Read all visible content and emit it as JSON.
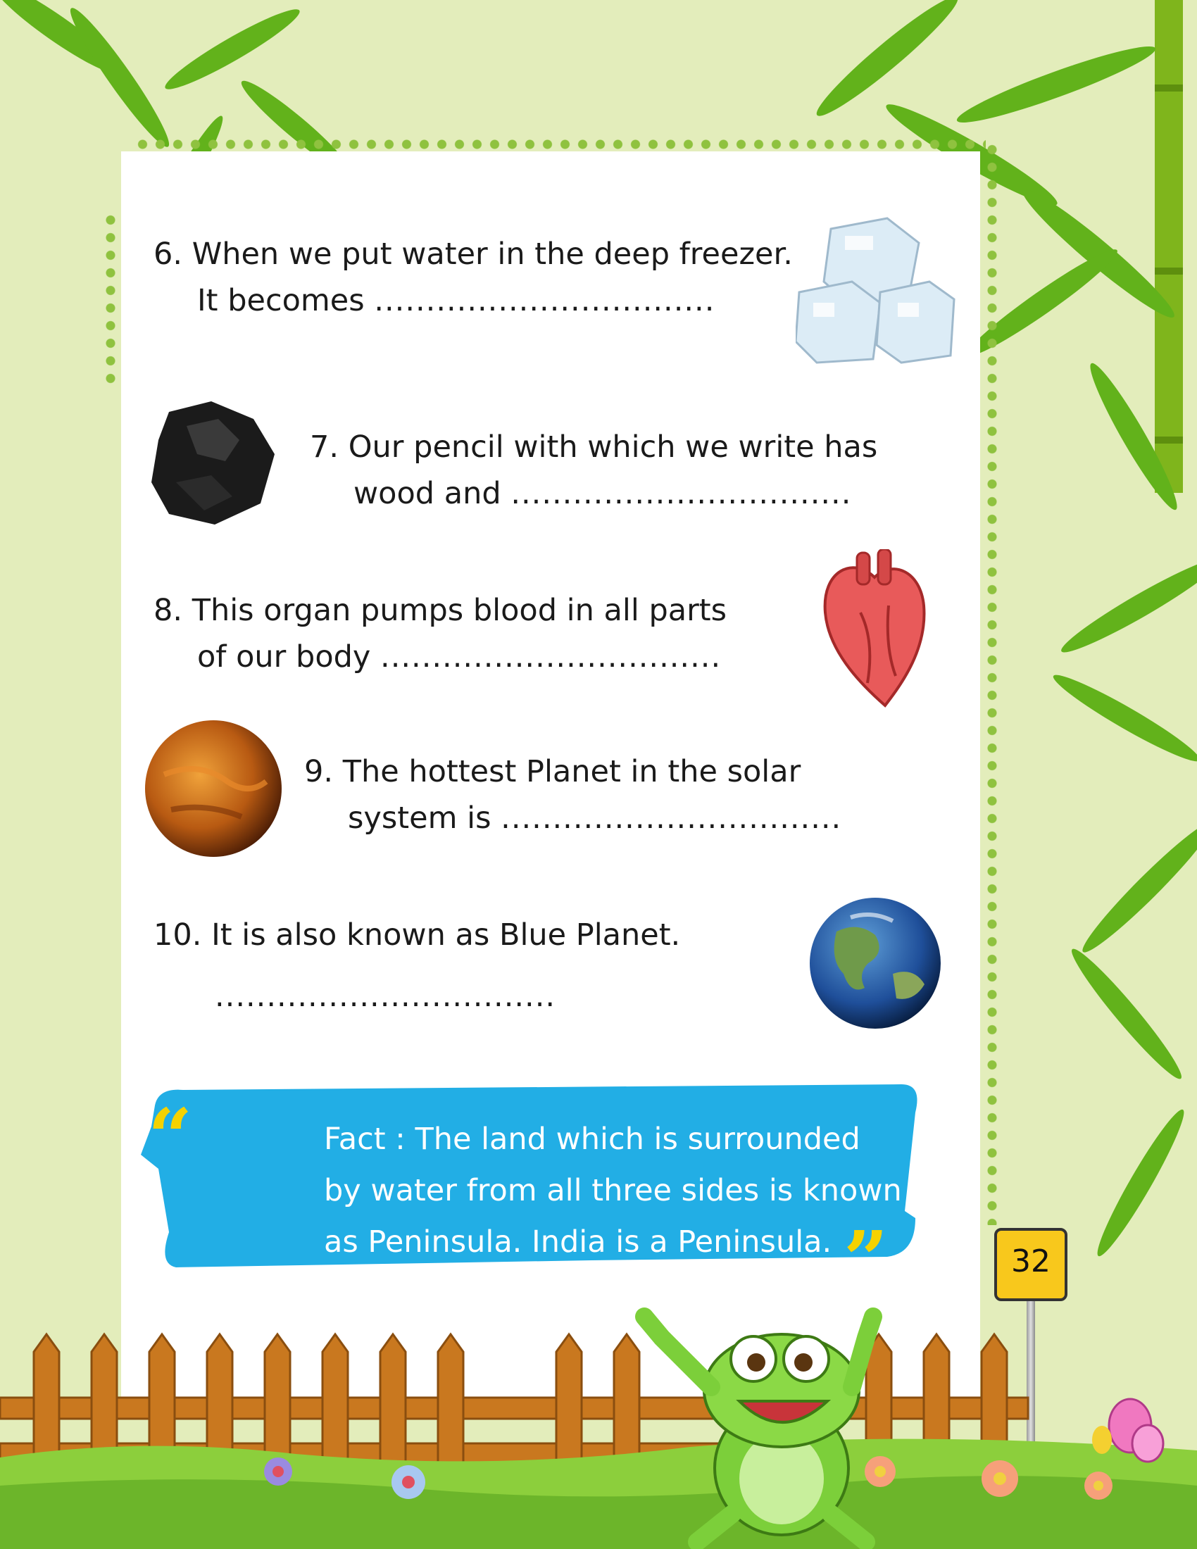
{
  "questions": [
    {
      "number": "6.",
      "line1": "When we put water in the deep freezer.",
      "line2": "It becomes",
      "blank": "................................."
    },
    {
      "number": "7.",
      "line1": "Our pencil with which we write has",
      "line2": "wood and",
      "blank": "................................."
    },
    {
      "number": "8.",
      "line1": "This organ pumps blood in all parts",
      "line2": "of our body",
      "blank": "................................."
    },
    {
      "number": "9.",
      "line1": "The hottest Planet in the solar",
      "line2": "system is",
      "blank": "................................."
    },
    {
      "number": "10.",
      "line1": "It is also known as Blue Planet.",
      "line2": "",
      "blank": "................................."
    }
  ],
  "fact": {
    "line1": "Fact : The land which is surrounded",
    "line2": "by water from all three sides is known",
    "line3": "as  Peninsula. India is a Peninsula.",
    "quote_open": "“",
    "quote_close": "”"
  },
  "page_number": "32",
  "icons": [
    "ice-cubes-icon",
    "graphite-rock-icon",
    "heart-organ-icon",
    "venus-planet-icon",
    "earth-planet-icon",
    "frog-mascot-icon",
    "bamboo-leaves-decoration",
    "wooden-fence-decoration",
    "butterfly-icon",
    "flower-icon"
  ],
  "colors": {
    "background": "#e3edbb",
    "dots": "#8fc23f",
    "fact_box": "#22aee5",
    "quote": "#f5d200",
    "page_sign": "#f8c81c",
    "fence": "#c9781f",
    "grass": "#8ccf3c"
  }
}
